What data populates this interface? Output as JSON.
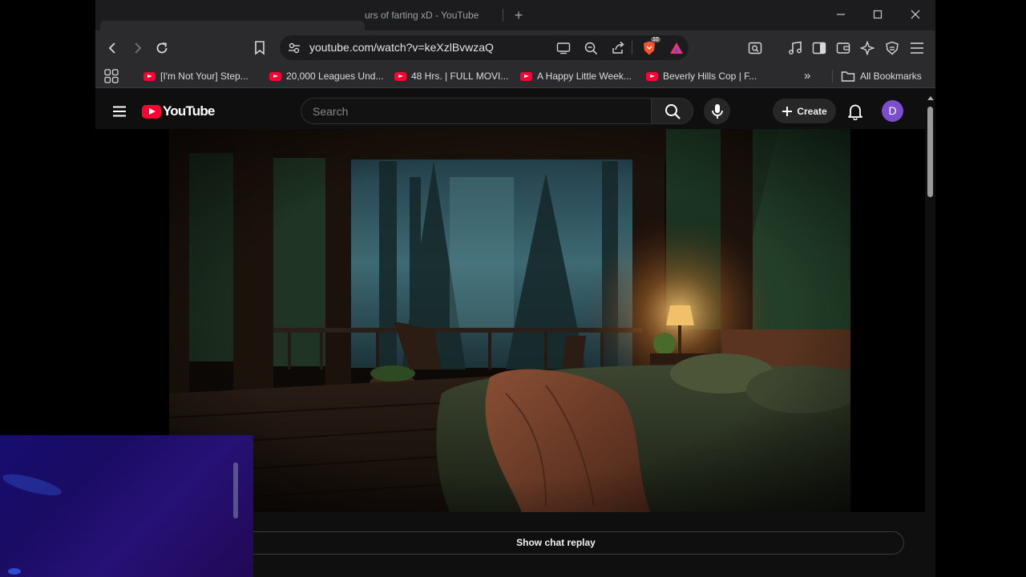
{
  "browser": {
    "tab_title": "urs of farting xD - YouTube",
    "url": "youtube.com/watch?v=keXzlBvwzaQ",
    "brave_badge": "10",
    "bookmarks": [
      "[I'm Not Your] Step...",
      "20,000 Leagues Und...",
      "48 Hrs. | FULL MOVI...",
      "A Happy Little Week...",
      "Beverly Hills Cop | F..."
    ],
    "bookmarks_overflow": "»",
    "all_bookmarks_label": "All Bookmarks"
  },
  "youtube": {
    "logo_text": "YouTube",
    "search_placeholder": "Search",
    "create_label": "Create",
    "avatar_initial": "D",
    "chat_replay_label": "Show chat replay"
  },
  "colors": {
    "youtube_red": "#ff0033",
    "avatar": "#7c4dcc",
    "page_bg": "#0f0f0f",
    "toolbar_bg": "#2b2b2e"
  },
  "icons": [
    "back-icon",
    "forward-icon",
    "reload-icon",
    "bookmark-icon",
    "site-settings-icon",
    "cast-icon",
    "zoom-icon",
    "share-icon",
    "brave-shields-icon",
    "brave-rewards-icon",
    "apps-grid-icon",
    "folder-icon",
    "menu-icon",
    "search-icon",
    "mic-icon",
    "plus-icon",
    "bell-icon",
    "music-icon",
    "sidebar-icon",
    "wallet-icon",
    "leo-icon",
    "vpn-icon"
  ]
}
